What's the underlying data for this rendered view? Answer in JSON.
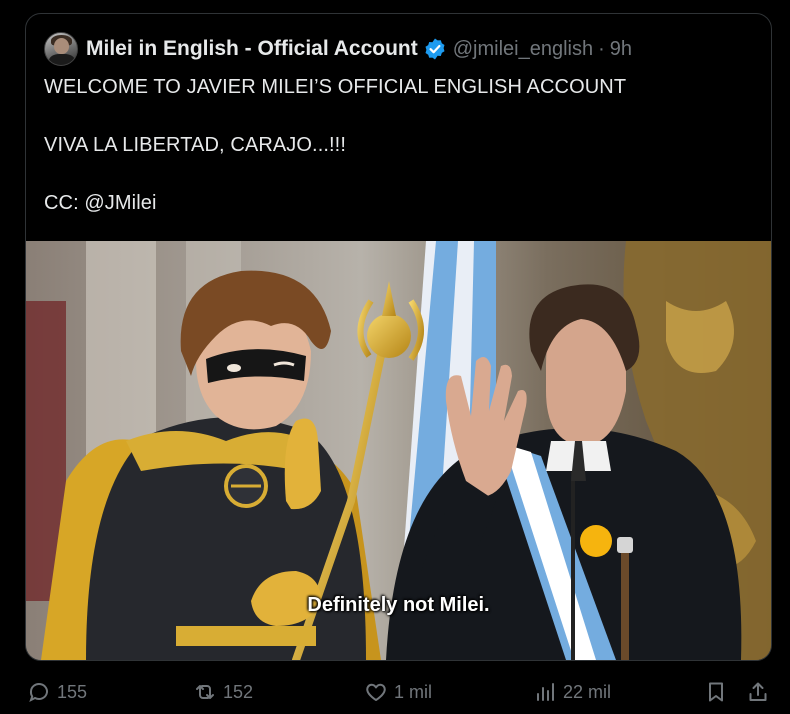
{
  "tweet": {
    "author_name": "Milei in English - Official Account",
    "handle": "@jmilei_english",
    "separator": "·",
    "time": "9h",
    "lines": [
      "WELCOME TO JAVIER MILEI’S OFFICIAL ENGLISH ACCOUNT",
      "VIVA LA LIBERTAD, CARAJO...!!!",
      "CC: @JMilei"
    ],
    "media_caption": "Definitely not Milei."
  },
  "actions": {
    "replies": "155",
    "reposts": "152",
    "likes": "1 mil",
    "views": "22 mil"
  },
  "icons": {
    "verified": "verified-badge-icon",
    "reply": "reply-icon",
    "repost": "repost-icon",
    "like": "heart-icon",
    "views": "views-chart-icon",
    "bookmark": "bookmark-icon",
    "share": "share-icon"
  },
  "colors": {
    "background": "#000000",
    "text": "#e7e9ea",
    "muted": "#71767b",
    "verified_blue": "#1d9bf0",
    "border": "#2f3336"
  }
}
